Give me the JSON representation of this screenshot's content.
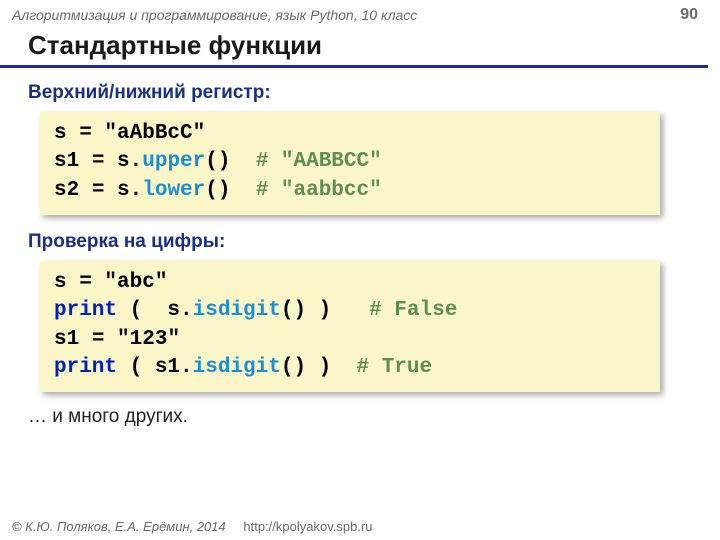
{
  "header": {
    "course": "Алгоритмизация и программирование, язык Python, 10 класс",
    "page": "90"
  },
  "title": "Стандартные функции",
  "sections": {
    "upperlower": {
      "label": "Верхний/нижний регистр:"
    },
    "digits": {
      "label": "Проверка на цифры:"
    }
  },
  "code1": {
    "l1_a": "s",
    "l1_b": " = ",
    "l1_c": "\"aAbBcC\"",
    "l2_a": "s1",
    "l2_b": " = ",
    "l2_c": "s",
    "l2_d": ".",
    "l2_e": "upper",
    "l2_f": "()",
    "l2_g": "  # \"AABBCC\"",
    "l3_a": "s2",
    "l3_b": " = ",
    "l3_c": "s",
    "l3_d": ".",
    "l3_e": "lower",
    "l3_f": "()",
    "l3_g": "  # \"aabbcc\""
  },
  "code2": {
    "l1_a": "s",
    "l1_b": " = ",
    "l1_c": "\"abc\"",
    "l2_a": "print",
    "l2_b": " (  s.",
    "l2_c": "isdigit",
    "l2_d": "() )   ",
    "l2_e": "# False",
    "l3_a": "s1",
    "l3_b": " = ",
    "l3_c": "\"123\"",
    "l4_a": "print",
    "l4_b": " ( s1.",
    "l4_c": "isdigit",
    "l4_d": "() )  ",
    "l4_e": "# True"
  },
  "more": "… и много других.",
  "footer": {
    "authors": "© К.Ю. Поляков, Е.А. Ерёмин, 2014",
    "url": "http://kpolyakov.spb.ru"
  }
}
